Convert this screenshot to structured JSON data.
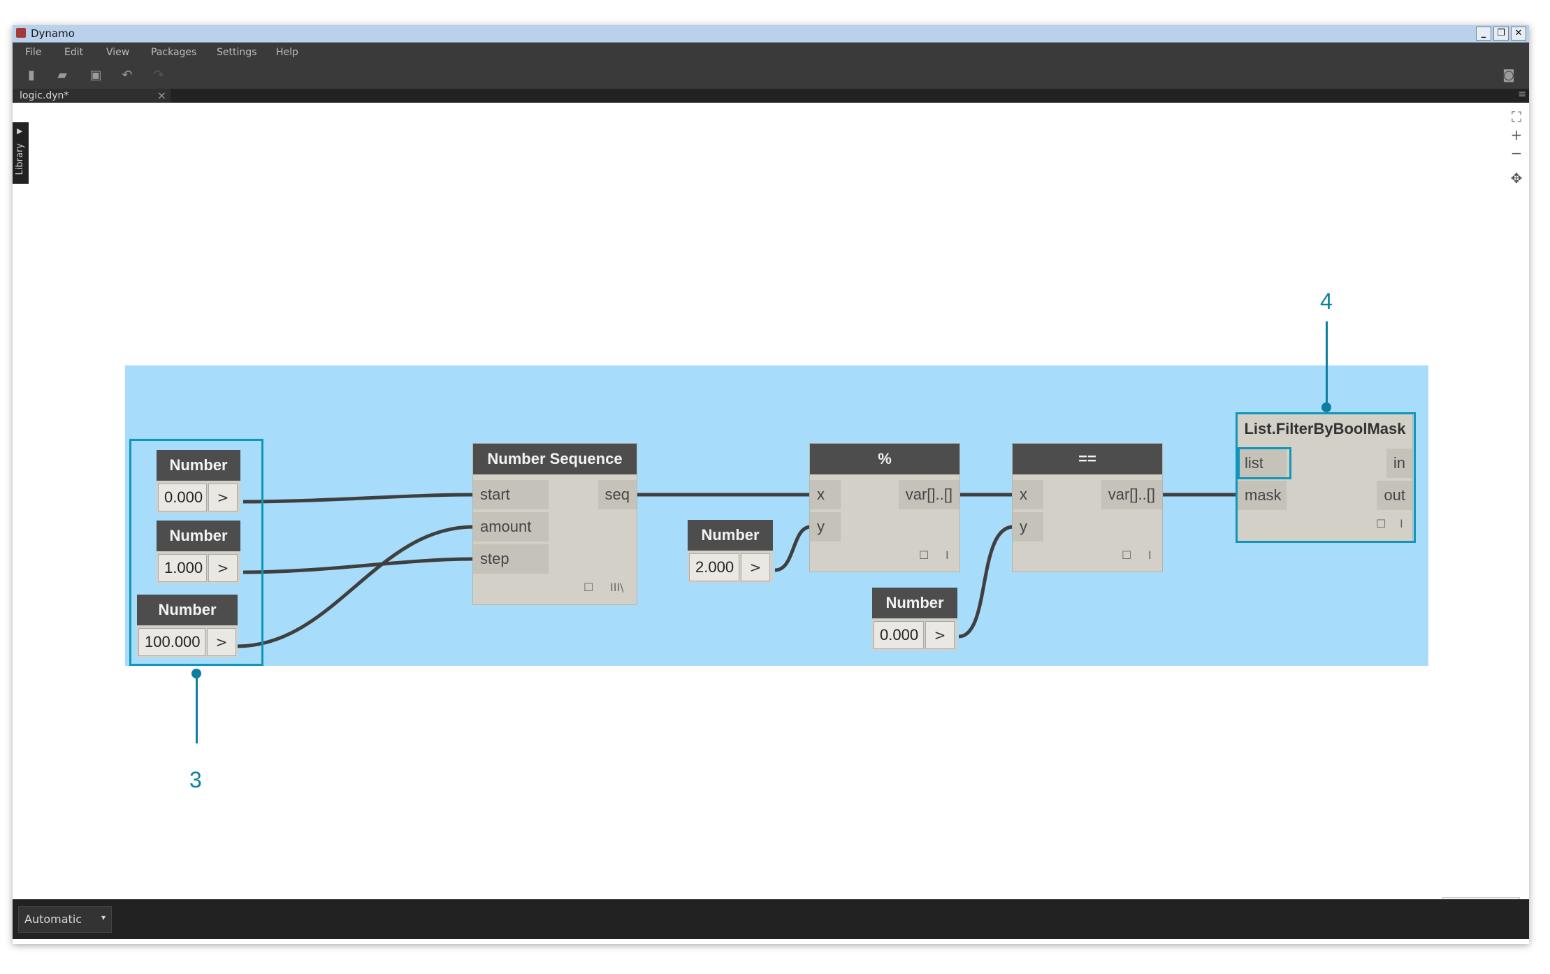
{
  "window": {
    "title": "Dynamo"
  },
  "menu": [
    "File",
    "Edit",
    "View",
    "Packages",
    "Settings",
    "Help"
  ],
  "toolbar": {
    "icons": [
      "new-file-icon",
      "open-file-icon",
      "save-icon",
      "undo-icon",
      "redo-icon",
      "camera-icon"
    ]
  },
  "tab": {
    "label": "logic.dyn*",
    "close": "×"
  },
  "library": {
    "label": "Library"
  },
  "zoom": {
    "fit": "⛶",
    "zoom_in": "+",
    "zoom_out": "−",
    "pan": "✥"
  },
  "nodes": {
    "num1": {
      "title": "Number",
      "value": "0.000",
      "button": ">"
    },
    "num2": {
      "title": "Number",
      "value": "1.000",
      "button": ">"
    },
    "num3": {
      "title": "Number",
      "value": "100.000",
      "button": ">"
    },
    "sequence": {
      "title": "Number Sequence",
      "inputs": [
        "start",
        "amount",
        "step"
      ],
      "output": "seq",
      "lacing": "III\\"
    },
    "num4": {
      "title": "Number",
      "value": "2.000",
      "button": ">"
    },
    "mod": {
      "title": "%",
      "inputs": [
        "x",
        "y"
      ],
      "output": "var[]..[]",
      "lacing": "I"
    },
    "num5": {
      "title": "Number",
      "value": "0.000",
      "button": ">"
    },
    "eq": {
      "title": "==",
      "inputs": [
        "x",
        "y"
      ],
      "output": "var[]..[]",
      "lacing": "I"
    },
    "filter": {
      "title": "List.FilterByBoolMask",
      "inputs": [
        "list",
        "mask"
      ],
      "outputs": [
        "in",
        "out"
      ],
      "lacing": "I"
    }
  },
  "callouts": {
    "three": "3",
    "four": "4"
  },
  "run": {
    "mode": "Automatic",
    "caret": "▾"
  },
  "colors": {
    "group": "#a8dcfb",
    "highlight": "#0e97b8",
    "node_header": "#4d4d4d"
  }
}
